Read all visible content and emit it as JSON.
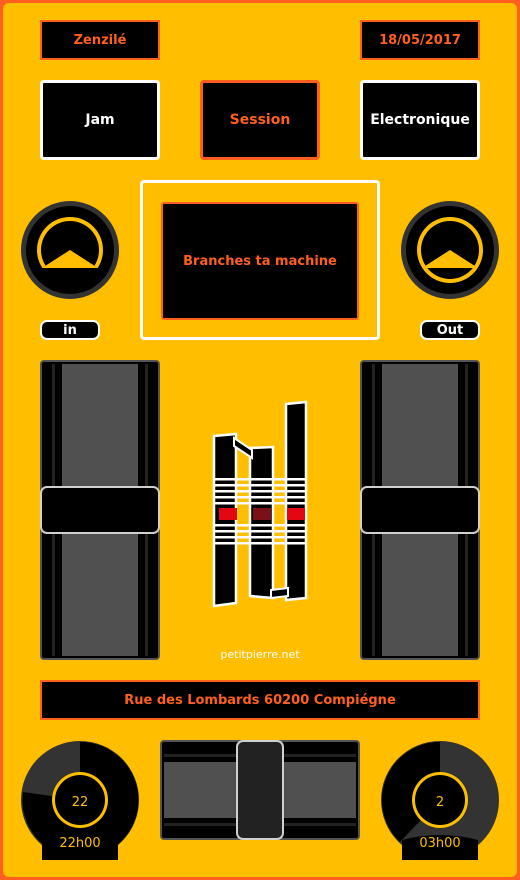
{
  "header": {
    "left_label": "Zenzilé",
    "date": "18/05/2017"
  },
  "modes": [
    {
      "label": "Jam",
      "active": false
    },
    {
      "label": "Session",
      "active": true
    },
    {
      "label": "Electronique",
      "active": false
    }
  ],
  "display": {
    "message": "Branches ta machine"
  },
  "knobs": {
    "in_label": "in",
    "out_label": "Out"
  },
  "footer": {
    "credit": "petitpierre.net",
    "address": "Rue des Lombards 60200 Compiégne"
  },
  "dials": {
    "left": {
      "value": "22",
      "time": "22h00"
    },
    "right": {
      "value": "2",
      "time": "03h00"
    }
  },
  "colors": {
    "panel": "#ffbf00",
    "accent": "#ff5f1f",
    "dark": "#000000",
    "track": "#505050",
    "logo_red": "#e30613"
  }
}
